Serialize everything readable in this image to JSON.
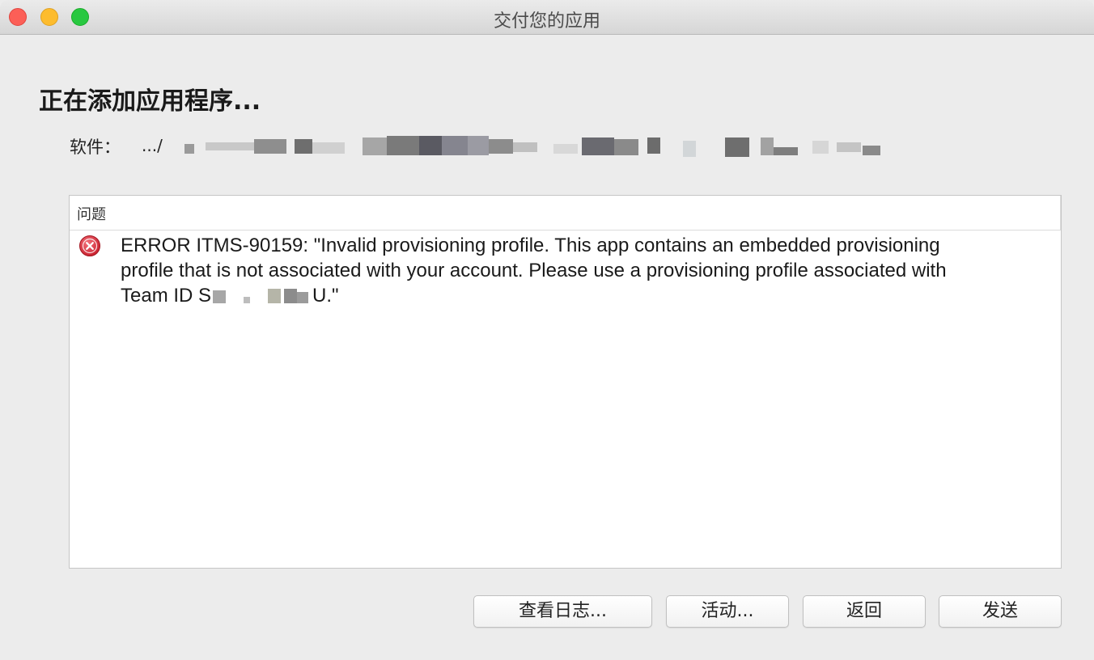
{
  "window": {
    "title": "交付您的应用"
  },
  "main": {
    "heading": "正在添加应用程序...",
    "software_label": "软件：",
    "software_path": ".../"
  },
  "issues": {
    "column_header": "问题",
    "items": [
      {
        "severity": "error",
        "icon": "error-icon",
        "line1": "ERROR ITMS-90159: \"Invalid provisioning profile. This app contains an embedded provisioning",
        "line2": "profile that is not associated with your account. Please use a provisioning profile associated with",
        "line3_prefix": "Team ID S",
        "line3_suffix": "U.\""
      }
    ]
  },
  "buttons": {
    "view_log": "查看日志...",
    "activity": "活动...",
    "back": "返回",
    "send": "发送"
  },
  "colors": {
    "error_red": "#d8303a",
    "window_bg": "#ececec",
    "close": "#fc5f57",
    "minimize": "#fdbc2e",
    "maximize": "#28c840"
  }
}
